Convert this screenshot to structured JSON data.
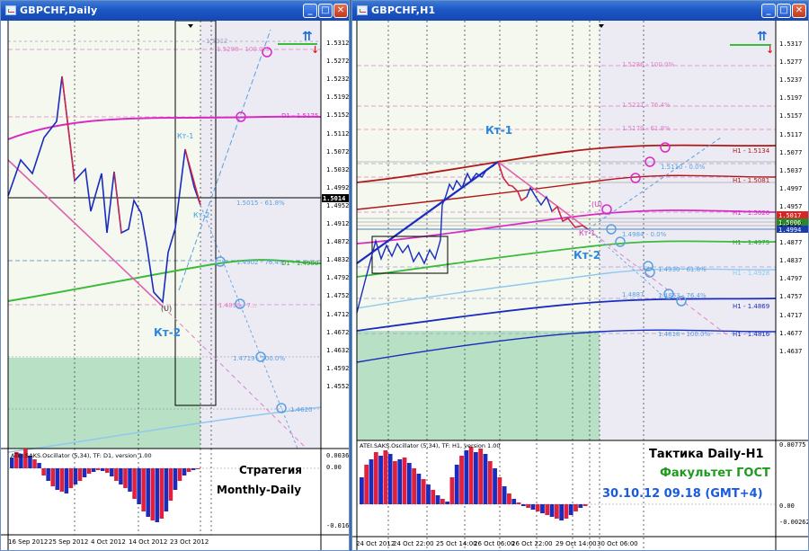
{
  "left_window": {
    "title": "GBPCHF,Daily",
    "buttons": {
      "minimize": "_",
      "maximize": "□",
      "close": "✕"
    },
    "price_axis": [
      "1.5312",
      "1.5272",
      "1.5232",
      "1.5192",
      "1.5152",
      "1.5112",
      "1.5072",
      "1.5032",
      "1.4992",
      "1.4952",
      "1.4912",
      "1.4872",
      "1.4832",
      "1.4792",
      "1.4752",
      "1.4712",
      "1.4672",
      "1.4632",
      "1.4592",
      "1.4552"
    ],
    "current_price": "1.5014",
    "osc_axis": [
      "0.00362",
      "0.00",
      "-0.01623"
    ],
    "time_axis": [
      "16 Sep 2012",
      "25 Sep 2012",
      "4 Oct 2012",
      "14 Oct 2012",
      "23 Oct 2012"
    ],
    "labels": {
      "kt1": "Кт-1",
      "kt2": "Кт-2",
      "kt2_small": "Кт-2",
      "u": "(U)",
      "top_level": "1.5312",
      "top_fib": "1.5298 - 100.0%",
      "d1_upper": "D1 - 1.5175",
      "fib_618": "1.5015 - 61.8%",
      "fib_764": "1.4902 - 76.4%",
      "d1_lower": "D1 - 1.4900",
      "fib_bottom": "1.4818 - 7...",
      "fib_100": "1.4719 - 100.0%",
      "fib_low": "1.4620"
    },
    "oscillator_title": "ATEI.SAKS.Oscillator (5,34), TF: D1, version 1.00",
    "strategy_line1": "Стратегия",
    "strategy_line2": "Monthly-Daily",
    "arrows_up": "⇈",
    "arrow_down": "↓"
  },
  "right_window": {
    "title": "GBPCHF,H1",
    "buttons": {
      "minimize": "_",
      "maximize": "□",
      "close": "✕"
    },
    "price_axis": [
      "1.5317",
      "1.5277",
      "1.5237",
      "1.5197",
      "1.5157",
      "1.5117",
      "1.5077",
      "1.5037",
      "1.4997",
      "1.4957",
      "1.4917",
      "1.4877",
      "1.4837",
      "1.4797",
      "1.4757",
      "1.4717",
      "1.4677",
      "1.4637"
    ],
    "price_tags": [
      "1.5017",
      "1.5006",
      "1.4994"
    ],
    "osc_axis": [
      "0.00775",
      "0.00",
      "-0.00262"
    ],
    "time_axis": [
      "24 Oct 2012",
      "24 Oct 22:00",
      "25 Oct 14:00",
      "26 Oct 06:00",
      "26 Oct 22:00",
      "29 Oct 14:00",
      "30 Oct 06:00"
    ],
    "labels": {
      "kt1": "Кт-1",
      "kt2": "Кт-2",
      "kt2_small": "Кт-1",
      "u": "(U)",
      "fib_top": "1.5286 - 100.0%",
      "fib_764": "1.5221 - 76.4%",
      "fib_618": "1.5179 - 61.8%",
      "h1_5134": "H1 - 1.5134",
      "fib_0": "1.5110 - 0.0%",
      "h1_5081": "H1 - 1.5081",
      "h1_5020": "H1 - 1.5020",
      "fib_low0": "1.4984 - 0.0%",
      "h1_4975": "H1 - 1.4975",
      "fib_618b": "1.4930 - 61.8%",
      "h1_4928": "H1 - 1.4928",
      "fib_4887": "1.4887",
      "fib_764b": "1.4863 - 76.4%",
      "h1_4869": "H1 - 1.4869",
      "fib_100b": "1.4818 - 100.0%",
      "h1_4816": "H1 - 1.4816"
    },
    "oscillator_title": "ATEI.SAKS.Oscillator (5,34), TF: H1, version 1.00",
    "tactic_line": "Тактика Daily-H1",
    "faculty_line": "Факультет ГОСТ",
    "datetime_line": "30.10.12   09.18 (GMT+4)",
    "arrows_up": "⇈",
    "arrow_down": "↓"
  },
  "colors": {
    "titlebar": "#1c57c5",
    "zone_green": "#b8e0c4",
    "zone_light": "#f4f8ee",
    "zone_lavender": "#ecebf4",
    "candle_blue": "#1a2bbf",
    "candle_red": "#e0203c",
    "magenta": "#d82bc4",
    "green_ma": "#3cba3c",
    "dark_red_ma": "#b01818",
    "pink_dashed": "#e080c8",
    "light_blue": "#5aa0e0"
  }
}
